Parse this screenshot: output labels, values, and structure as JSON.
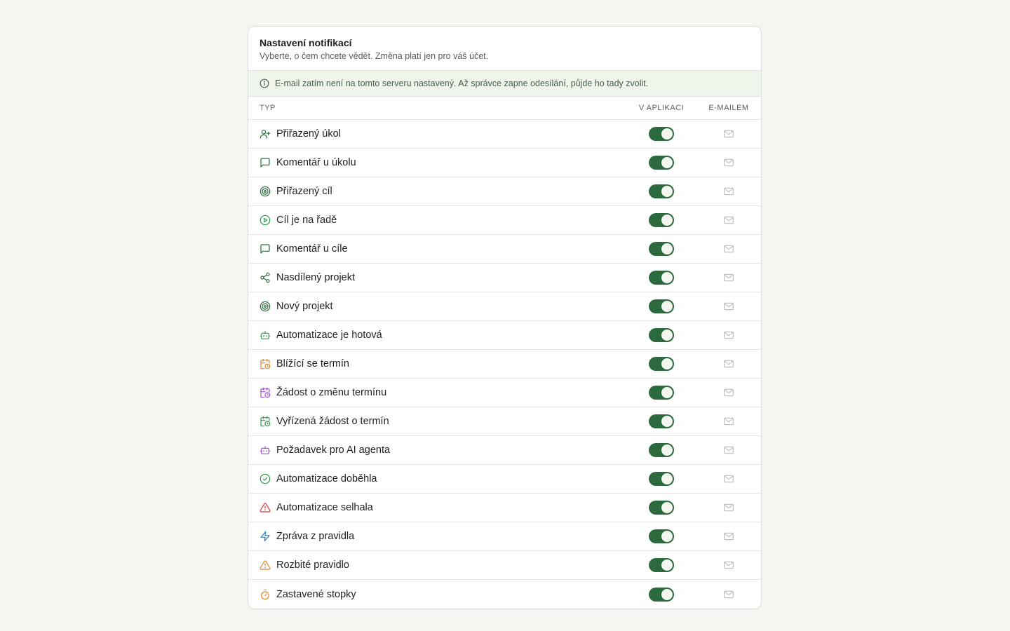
{
  "header": {
    "title": "Nastavení notifikací",
    "subtitle": "Vyberte, o čem chcete vědět. Změna platí jen pro váš účet."
  },
  "banner": {
    "icon": "info-icon",
    "text": "E-mail zatím není na tomto serveru nastavený. Až správce zapne odesílání, půjde ho tady zvolit."
  },
  "table": {
    "columns": {
      "type": "TYP",
      "in_app": "V APLIKACI",
      "email": "E-MAILEM"
    },
    "rows": [
      {
        "label": "Přiřazený úkol",
        "icon": "user-plus-icon",
        "icon_color": "#2a6a3c",
        "in_app": true,
        "email_enabled": false
      },
      {
        "label": "Komentář u úkolu",
        "icon": "comment-icon",
        "icon_color": "#2a6a3c",
        "in_app": true,
        "email_enabled": false
      },
      {
        "label": "Přiřazený cíl",
        "icon": "target-icon",
        "icon_color": "#2a6a3c",
        "in_app": true,
        "email_enabled": false
      },
      {
        "label": "Cíl je na řadě",
        "icon": "play-circle-icon",
        "icon_color": "#2e9d4c",
        "in_app": true,
        "email_enabled": false
      },
      {
        "label": "Komentář u cíle",
        "icon": "comment-icon",
        "icon_color": "#2a6a3c",
        "in_app": true,
        "email_enabled": false
      },
      {
        "label": "Nasdílený projekt",
        "icon": "share-icon",
        "icon_color": "#2a6a3c",
        "in_app": true,
        "email_enabled": false
      },
      {
        "label": "Nový projekt",
        "icon": "target-icon",
        "icon_color": "#2a6a3c",
        "in_app": true,
        "email_enabled": false
      },
      {
        "label": "Automatizace je hotová",
        "icon": "bot-icon",
        "icon_color": "#2e9d4c",
        "in_app": true,
        "email_enabled": false
      },
      {
        "label": "Blížící se termín",
        "icon": "calendar-clock-icon",
        "icon_color": "#e0862a",
        "in_app": true,
        "email_enabled": false
      },
      {
        "label": "Žádost o změnu termínu",
        "icon": "calendar-clock-icon",
        "icon_color": "#9b4fd0",
        "in_app": true,
        "email_enabled": false
      },
      {
        "label": "Vyřízená žádost o termín",
        "icon": "calendar-clock-icon",
        "icon_color": "#2e9d4c",
        "in_app": true,
        "email_enabled": false
      },
      {
        "label": "Požadavek pro AI agenta",
        "icon": "bot-icon",
        "icon_color": "#9b4fd0",
        "in_app": true,
        "email_enabled": false
      },
      {
        "label": "Automatizace doběhla",
        "icon": "check-circle-icon",
        "icon_color": "#2e9d4c",
        "in_app": true,
        "email_enabled": false
      },
      {
        "label": "Automatizace selhala",
        "icon": "warning-triangle-icon",
        "icon_color": "#d63a3a",
        "in_app": true,
        "email_enabled": false
      },
      {
        "label": "Zpráva z pravidla",
        "icon": "lightning-icon",
        "icon_color": "#2b7fc9",
        "in_app": true,
        "email_enabled": false
      },
      {
        "label": "Rozbité pravidlo",
        "icon": "warning-triangle-icon",
        "icon_color": "#e0862a",
        "in_app": true,
        "email_enabled": false
      },
      {
        "label": "Zastavené stopky",
        "icon": "stopwatch-icon",
        "icon_color": "#e0862a",
        "in_app": true,
        "email_enabled": false
      }
    ]
  },
  "colors": {
    "accent": "#2a6a3c",
    "toggle_knob": "#f4f7ef",
    "disabled_icon": "#b9bdb6",
    "banner_bg": "#eff5ea"
  }
}
